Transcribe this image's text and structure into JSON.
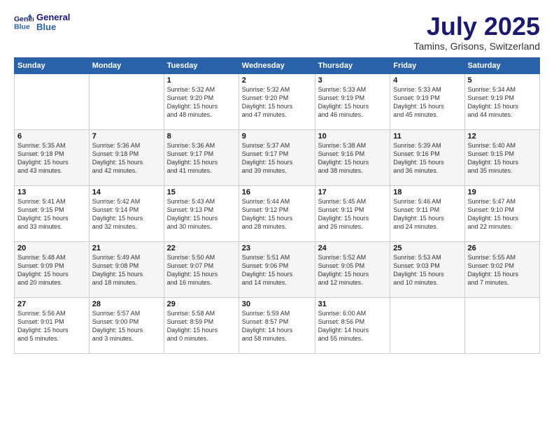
{
  "logo": {
    "line1": "General",
    "line2": "Blue"
  },
  "title": "July 2025",
  "location": "Tamins, Grisons, Switzerland",
  "days_of_week": [
    "Sunday",
    "Monday",
    "Tuesday",
    "Wednesday",
    "Thursday",
    "Friday",
    "Saturday"
  ],
  "weeks": [
    [
      {
        "day": "",
        "info": ""
      },
      {
        "day": "",
        "info": ""
      },
      {
        "day": "1",
        "info": "Sunrise: 5:32 AM\nSunset: 9:20 PM\nDaylight: 15 hours\nand 48 minutes."
      },
      {
        "day": "2",
        "info": "Sunrise: 5:32 AM\nSunset: 9:20 PM\nDaylight: 15 hours\nand 47 minutes."
      },
      {
        "day": "3",
        "info": "Sunrise: 5:33 AM\nSunset: 9:19 PM\nDaylight: 15 hours\nand 46 minutes."
      },
      {
        "day": "4",
        "info": "Sunrise: 5:33 AM\nSunset: 9:19 PM\nDaylight: 15 hours\nand 45 minutes."
      },
      {
        "day": "5",
        "info": "Sunrise: 5:34 AM\nSunset: 9:19 PM\nDaylight: 15 hours\nand 44 minutes."
      }
    ],
    [
      {
        "day": "6",
        "info": "Sunrise: 5:35 AM\nSunset: 9:18 PM\nDaylight: 15 hours\nand 43 minutes."
      },
      {
        "day": "7",
        "info": "Sunrise: 5:36 AM\nSunset: 9:18 PM\nDaylight: 15 hours\nand 42 minutes."
      },
      {
        "day": "8",
        "info": "Sunrise: 5:36 AM\nSunset: 9:17 PM\nDaylight: 15 hours\nand 41 minutes."
      },
      {
        "day": "9",
        "info": "Sunrise: 5:37 AM\nSunset: 9:17 PM\nDaylight: 15 hours\nand 39 minutes."
      },
      {
        "day": "10",
        "info": "Sunrise: 5:38 AM\nSunset: 9:16 PM\nDaylight: 15 hours\nand 38 minutes."
      },
      {
        "day": "11",
        "info": "Sunrise: 5:39 AM\nSunset: 9:16 PM\nDaylight: 15 hours\nand 36 minutes."
      },
      {
        "day": "12",
        "info": "Sunrise: 5:40 AM\nSunset: 9:15 PM\nDaylight: 15 hours\nand 35 minutes."
      }
    ],
    [
      {
        "day": "13",
        "info": "Sunrise: 5:41 AM\nSunset: 9:15 PM\nDaylight: 15 hours\nand 33 minutes."
      },
      {
        "day": "14",
        "info": "Sunrise: 5:42 AM\nSunset: 9:14 PM\nDaylight: 15 hours\nand 32 minutes."
      },
      {
        "day": "15",
        "info": "Sunrise: 5:43 AM\nSunset: 9:13 PM\nDaylight: 15 hours\nand 30 minutes."
      },
      {
        "day": "16",
        "info": "Sunrise: 5:44 AM\nSunset: 9:12 PM\nDaylight: 15 hours\nand 28 minutes."
      },
      {
        "day": "17",
        "info": "Sunrise: 5:45 AM\nSunset: 9:11 PM\nDaylight: 15 hours\nand 26 minutes."
      },
      {
        "day": "18",
        "info": "Sunrise: 5:46 AM\nSunset: 9:11 PM\nDaylight: 15 hours\nand 24 minutes."
      },
      {
        "day": "19",
        "info": "Sunrise: 5:47 AM\nSunset: 9:10 PM\nDaylight: 15 hours\nand 22 minutes."
      }
    ],
    [
      {
        "day": "20",
        "info": "Sunrise: 5:48 AM\nSunset: 9:09 PM\nDaylight: 15 hours\nand 20 minutes."
      },
      {
        "day": "21",
        "info": "Sunrise: 5:49 AM\nSunset: 9:08 PM\nDaylight: 15 hours\nand 18 minutes."
      },
      {
        "day": "22",
        "info": "Sunrise: 5:50 AM\nSunset: 9:07 PM\nDaylight: 15 hours\nand 16 minutes."
      },
      {
        "day": "23",
        "info": "Sunrise: 5:51 AM\nSunset: 9:06 PM\nDaylight: 15 hours\nand 14 minutes."
      },
      {
        "day": "24",
        "info": "Sunrise: 5:52 AM\nSunset: 9:05 PM\nDaylight: 15 hours\nand 12 minutes."
      },
      {
        "day": "25",
        "info": "Sunrise: 5:53 AM\nSunset: 9:03 PM\nDaylight: 15 hours\nand 10 minutes."
      },
      {
        "day": "26",
        "info": "Sunrise: 5:55 AM\nSunset: 9:02 PM\nDaylight: 15 hours\nand 7 minutes."
      }
    ],
    [
      {
        "day": "27",
        "info": "Sunrise: 5:56 AM\nSunset: 9:01 PM\nDaylight: 15 hours\nand 5 minutes."
      },
      {
        "day": "28",
        "info": "Sunrise: 5:57 AM\nSunset: 9:00 PM\nDaylight: 15 hours\nand 3 minutes."
      },
      {
        "day": "29",
        "info": "Sunrise: 5:58 AM\nSunset: 8:59 PM\nDaylight: 15 hours\nand 0 minutes."
      },
      {
        "day": "30",
        "info": "Sunrise: 5:59 AM\nSunset: 8:57 PM\nDaylight: 14 hours\nand 58 minutes."
      },
      {
        "day": "31",
        "info": "Sunrise: 6:00 AM\nSunset: 8:56 PM\nDaylight: 14 hours\nand 55 minutes."
      },
      {
        "day": "",
        "info": ""
      },
      {
        "day": "",
        "info": ""
      }
    ]
  ]
}
